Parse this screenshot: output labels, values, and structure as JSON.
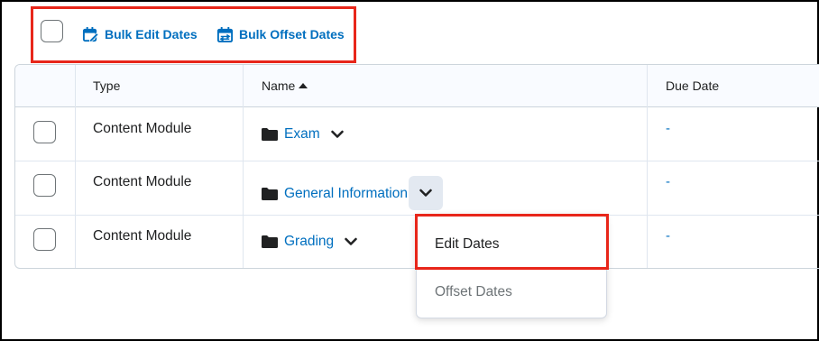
{
  "toolbar": {
    "bulk_edit_label": "Bulk Edit Dates",
    "bulk_offset_label": "Bulk Offset Dates",
    "accent_color": "#006fbf",
    "highlight_color": "#e8261a"
  },
  "table": {
    "columns": [
      {
        "label": ""
      },
      {
        "label": "Type"
      },
      {
        "label": "Name",
        "sort": "ascending"
      },
      {
        "label": "Due Date"
      }
    ],
    "rows": [
      {
        "type": "Content Module",
        "name": "Exam",
        "due": "-"
      },
      {
        "type": "Content Module",
        "name": "General Information",
        "due": "-"
      },
      {
        "type": "Content Module",
        "name": "Grading",
        "due": "-"
      }
    ]
  },
  "menu": {
    "items": [
      {
        "label": "Edit Dates",
        "highlighted": true
      },
      {
        "label": "Offset Dates"
      }
    ]
  },
  "icons": {
    "bulk_edit": "calendar-edit-icon",
    "bulk_offset": "calendar-offset-icon",
    "folder": "folder-icon",
    "chevron": "chevron-down-icon",
    "sort": "sort-ascending-icon"
  }
}
